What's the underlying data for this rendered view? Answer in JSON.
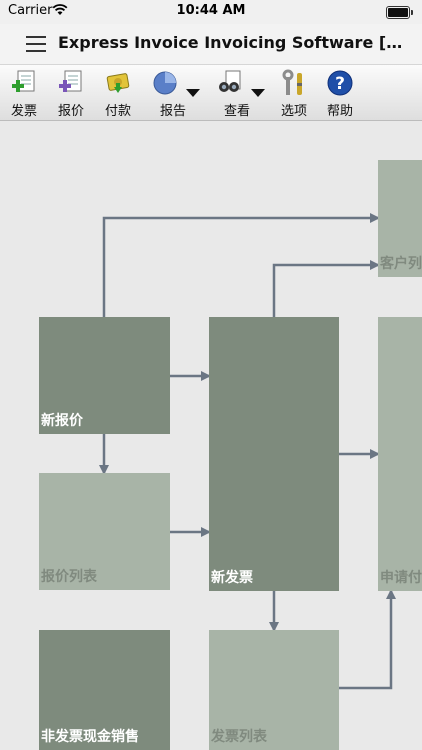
{
  "status": {
    "carrier": "Carrier",
    "time": "10:44 AM"
  },
  "titlebar": {
    "title": "Express Invoice Invoicing Software [Sher..."
  },
  "toolbar": {
    "items": [
      {
        "label": "发票",
        "icon": "new-invoice-icon"
      },
      {
        "label": "报价",
        "icon": "new-quote-icon"
      },
      {
        "label": "付款",
        "icon": "payment-icon"
      },
      {
        "label": "报告",
        "icon": "report-icon",
        "dropdown": true
      },
      {
        "label": "查看",
        "icon": "view-icon",
        "dropdown": true
      },
      {
        "label": "选项",
        "icon": "options-icon"
      },
      {
        "label": "帮助",
        "icon": "help-icon"
      }
    ]
  },
  "flow": {
    "nodes": {
      "new_quote": "新报价",
      "quote_list": "报价列表",
      "non_invoice_cash_sale": "非发票现金销售",
      "new_invoice": "新发票",
      "invoice_list": "发票列表",
      "customer_list": "客户列",
      "apply_payment": "申请付"
    }
  },
  "colors": {
    "node_dark": "#7e8b7d",
    "node_light": "#a8b4a7",
    "connector": "#6b7684",
    "background": "#e9e9e9"
  }
}
